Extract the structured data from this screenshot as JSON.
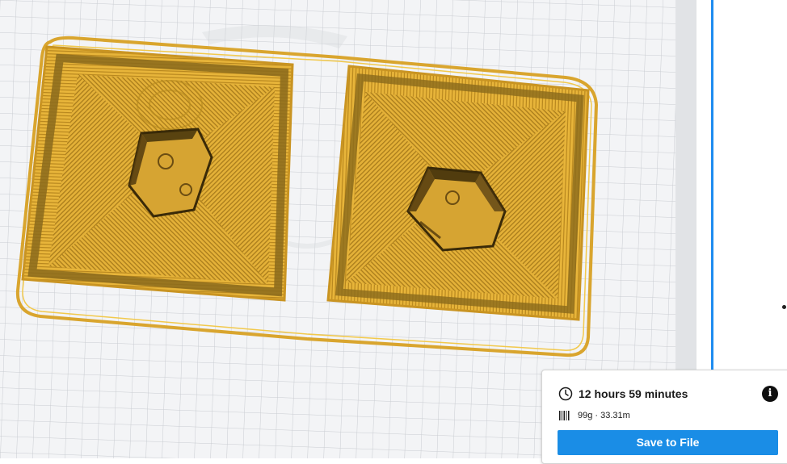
{
  "colors": {
    "layer_fill": "#e6b63a",
    "layer_dark": "#8a6a1c",
    "layer_line": "#b88a1e",
    "plate": "#f3f4f6",
    "grid": "#c9ccd1",
    "accent": "#1a8de6"
  },
  "print_info": {
    "time_icon": "clock-icon",
    "print_time": "12 hours 59 minutes",
    "info_icon": "info-icon",
    "info_glyph": "i",
    "material_icon": "filament-spool-icon",
    "material": "99g · 33.31m",
    "save_label": "Save to File"
  }
}
